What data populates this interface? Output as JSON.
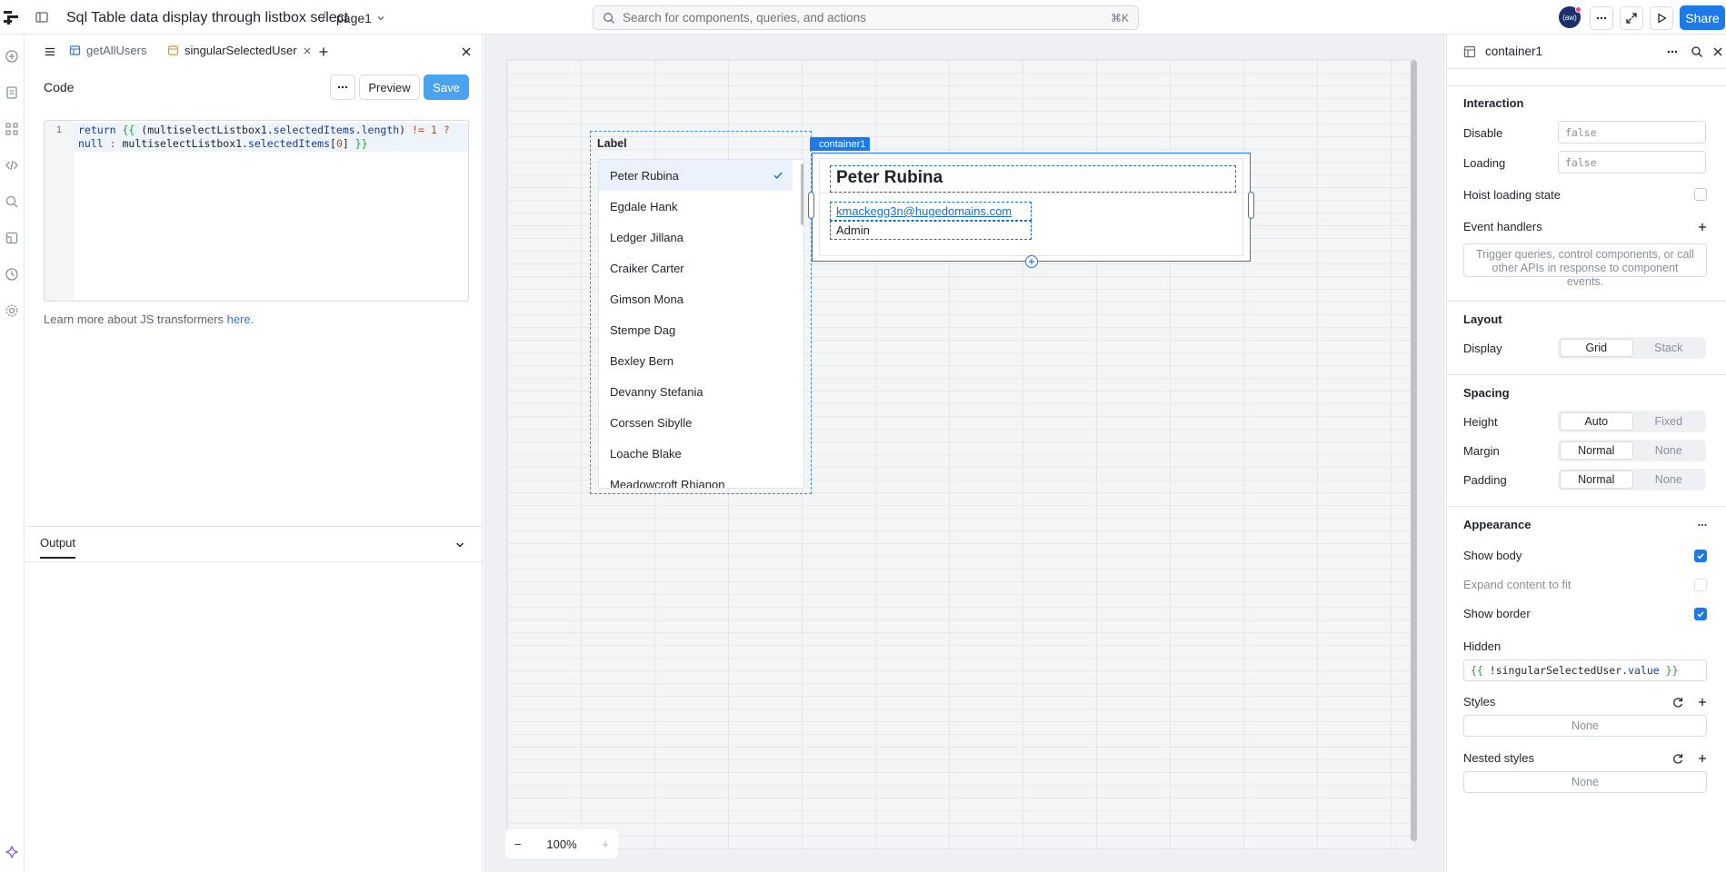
{
  "topbar": {
    "app_title": "Sql Table data display through listbox select",
    "breadcrumb_sep": "/",
    "page_name": "page1",
    "search_placeholder": "Search for components, queries, and actions",
    "search_shortcut": "⌘K",
    "avatar_initials": "(aw)",
    "share_label": "Share"
  },
  "code_panel": {
    "tabs": [
      {
        "label": "getAllUsers",
        "icon": "table-icon"
      },
      {
        "label": "singularSelectedUser",
        "icon": "transformer-icon",
        "active": true
      }
    ],
    "header_title": "Code",
    "preview_label": "Preview",
    "save_label": "Save",
    "line_number": "1",
    "learn_prefix": "Learn more about JS transformers ",
    "learn_link": "here",
    "learn_suffix": ".",
    "output_label": "Output"
  },
  "canvas": {
    "listbox_label": "Label",
    "listbox_items": [
      "Peter Rubina",
      "Egdale Hank",
      "Ledger Jillana",
      "Craiker Carter",
      "Gimson Mona",
      "Stempe Dag",
      "Bexley Bern",
      "Devanny Stefania",
      "Corssen Sibylle",
      "Loache Blake",
      "Meadowcroft Rhianon"
    ],
    "selected_index": 0,
    "container_tag": "container1",
    "user_name": "Peter Rubina",
    "user_email": "kmackegg3n@hugedomains.com",
    "user_role": "Admin",
    "zoom": "100%",
    "zoom_minus": "−",
    "zoom_plus": "+"
  },
  "inspector": {
    "title": "container1",
    "interaction": "Interaction",
    "disable_label": "Disable",
    "disable_value": "false",
    "loading_label": "Loading",
    "loading_value": "false",
    "hoist_label": "Hoist loading state",
    "event_handlers_label": "Event handlers",
    "event_handlers_hint": "Trigger queries, control components, or call other APIs in response to component events.",
    "layout": "Layout",
    "display_label": "Display",
    "display_options": [
      "Grid",
      "Stack"
    ],
    "spacing": "Spacing",
    "height_label": "Height",
    "height_options": [
      "Auto",
      "Fixed"
    ],
    "margin_label": "Margin",
    "margin_options": [
      "Normal",
      "None"
    ],
    "padding_label": "Padding",
    "padding_options": [
      "Normal",
      "None"
    ],
    "appearance": "Appearance",
    "show_body_label": "Show body",
    "expand_label": "Expand content to fit",
    "show_border_label": "Show border",
    "hidden_label": "Hidden",
    "styles_label": "Styles",
    "styles_value": "None",
    "nested_styles_label": "Nested styles",
    "nested_styles_value": "None"
  },
  "colors": {
    "accent": "#1e7ae6",
    "save_button": "#4aa3ee",
    "canvas_bg": "#eef0f3"
  }
}
